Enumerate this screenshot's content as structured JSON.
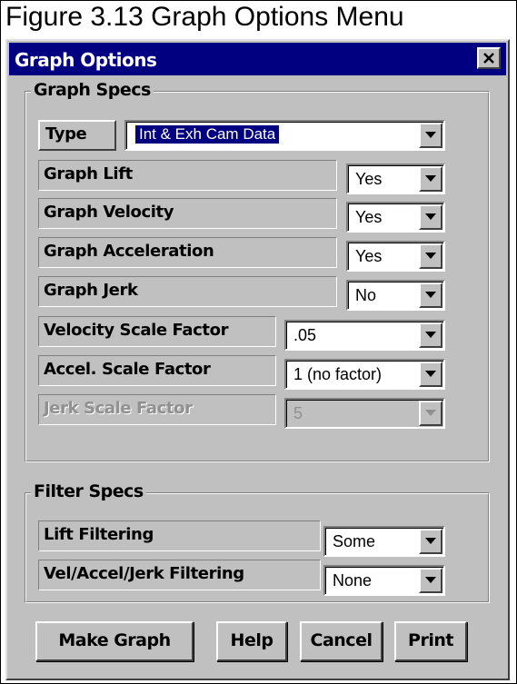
{
  "caption": "Figure 3.13  Graph Options Menu",
  "window": {
    "title": "Graph Options",
    "close_icon": "close-icon"
  },
  "graph_specs": {
    "legend": "Graph Specs",
    "type": {
      "label": "Type",
      "value": "Int & Exh Cam Data"
    },
    "rows": [
      {
        "label": "Graph Lift",
        "value": "Yes",
        "enabled": true
      },
      {
        "label": "Graph Velocity",
        "value": "Yes",
        "enabled": true
      },
      {
        "label": "Graph Acceleration",
        "value": "Yes",
        "enabled": true
      },
      {
        "label": "Graph Jerk",
        "value": "No",
        "enabled": true
      },
      {
        "label": "Velocity Scale Factor",
        "value": ".05",
        "enabled": true
      },
      {
        "label": "Accel. Scale Factor",
        "value": "1 (no factor)",
        "enabled": true
      },
      {
        "label": "Jerk Scale Factor",
        "value": "5",
        "enabled": false
      }
    ]
  },
  "filter_specs": {
    "legend": "Filter Specs",
    "rows": [
      {
        "label": "Lift Filtering",
        "value": "Some",
        "enabled": true
      },
      {
        "label": "Vel/Accel/Jerk Filtering",
        "value": "None",
        "enabled": true
      }
    ]
  },
  "buttons": {
    "make_graph": "Make Graph",
    "help": "Help",
    "cancel": "Cancel",
    "print": "Print"
  },
  "colors": {
    "title_bar": "#000080",
    "face": "#c0c0c0",
    "selection": "#000080"
  }
}
